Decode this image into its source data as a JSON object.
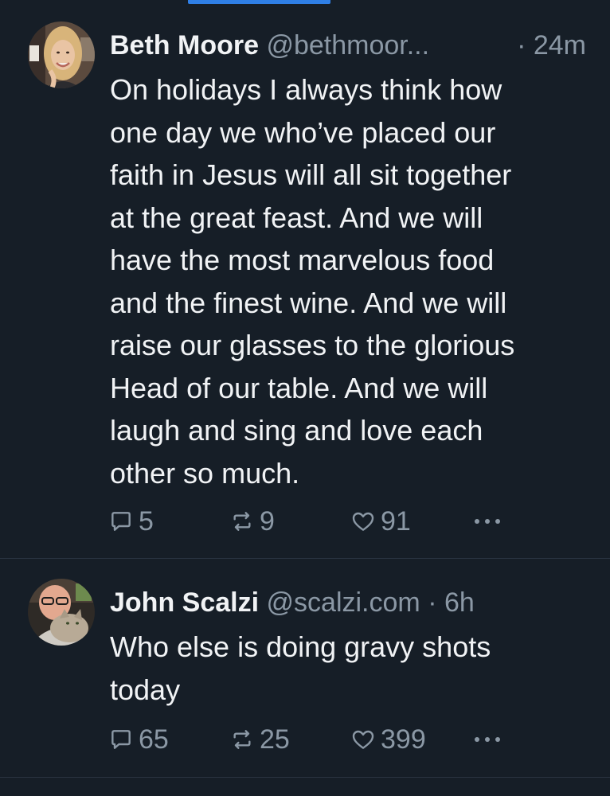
{
  "posts": [
    {
      "author_name": "Beth Moore",
      "handle": "@bethmoor...",
      "time": "· 24m",
      "text": "On holidays I always think how\none day we who’ve placed our\nfaith in Jesus will all sit together\nat the great feast. And we will\nhave the most marvelous food\nand the finest wine. And we will\nraise our glasses to the glorious\nHead of our table. And we will\nlaugh and sing and love each\nother so much.",
      "replies": "5",
      "reposts": "9",
      "likes": "91"
    },
    {
      "author_name": "John Scalzi",
      "handle": "@scalzi.com",
      "time": "· 6h",
      "text": "Who else is doing gravy shots\ntoday",
      "replies": "65",
      "reposts": "25",
      "likes": "399"
    }
  ],
  "icons": {
    "reply": "speech-bubble-icon",
    "repost": "repost-arrows-icon",
    "like": "heart-icon",
    "more": "ellipsis-icon"
  },
  "colors": {
    "background": "#161e27",
    "text": "#f1f3f5",
    "muted": "#8b98a5",
    "accent": "#2f7fe6",
    "divider": "#2a3441"
  }
}
